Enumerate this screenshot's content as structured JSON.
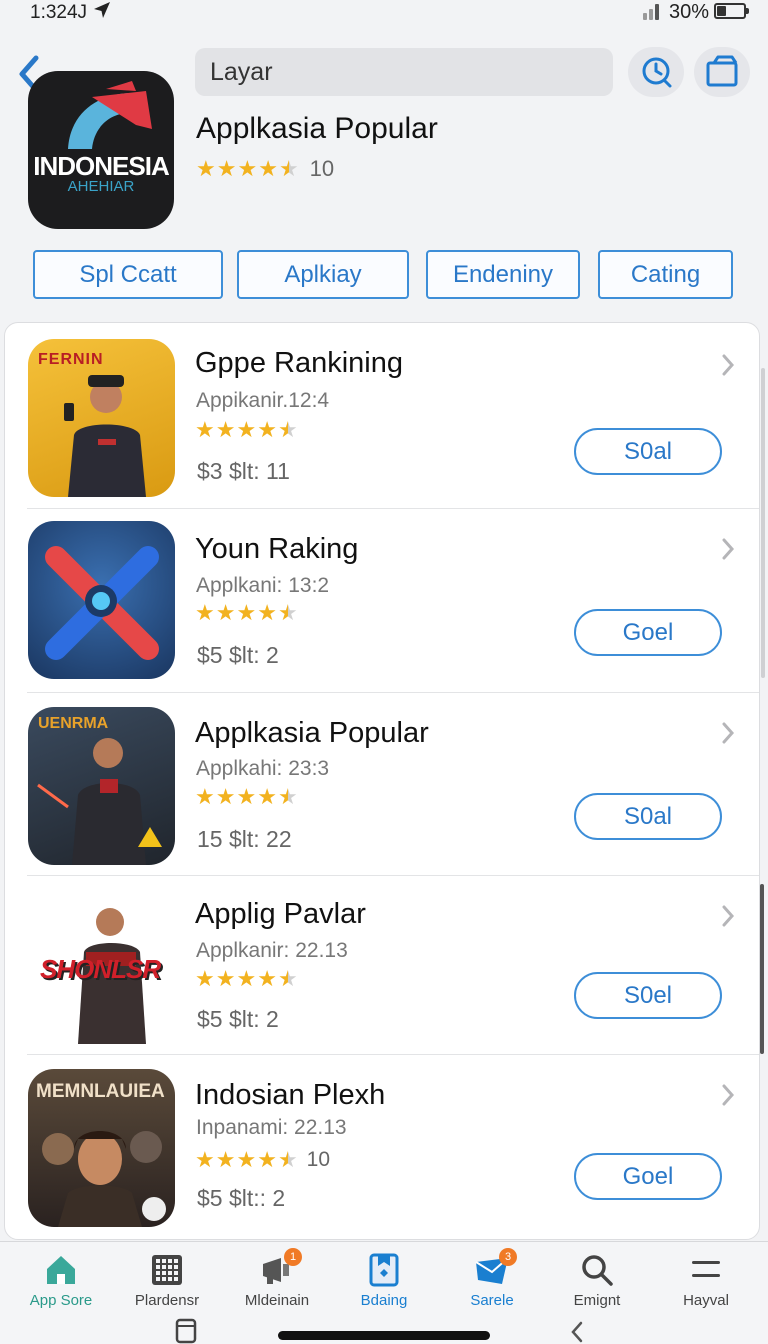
{
  "status": {
    "time": "1:324J",
    "battery": "30%"
  },
  "header": {
    "search_value": "Layar",
    "hero_title": "Applkasia Popular",
    "hero_rating_count": "10",
    "hero_icon_text": "INDONESIA",
    "hero_icon_subtext": "AHEHIAR",
    "hero_rating": 4.5
  },
  "chips": [
    {
      "label": "Spl Ccatt"
    },
    {
      "label": "Aplkiay"
    },
    {
      "label": "Endeniny"
    },
    {
      "label": "Cating"
    }
  ],
  "apps": [
    {
      "name": "Gppe Rankining",
      "sub": "Appikanir.12:4",
      "rating": 4.5,
      "rating_count": "",
      "price": "$3  $lt: 11",
      "button": "S0al",
      "icon_text": "FERNIN"
    },
    {
      "name": "Youn Raking",
      "sub": "Applkani: 13:2",
      "rating": 4.5,
      "rating_count": "",
      "price": "$5  $lt:  2",
      "button": "Goel",
      "icon_text": ""
    },
    {
      "name": "Applkasia Popular",
      "sub": "Applkahi: 23:3",
      "rating": 4.5,
      "rating_count": "",
      "price": "15  $lt: 22",
      "button": "S0al",
      "icon_text": "UENRMA"
    },
    {
      "name": "Applig Pavlar",
      "sub": "Applkanir: 22.13",
      "rating": 4.5,
      "rating_count": "",
      "price": "$5  $lt:  2",
      "button": "S0el",
      "icon_text": "SHONLSR"
    },
    {
      "name": "Indosian Plexh",
      "sub": "Inpanami: 22.13",
      "rating": 4.5,
      "rating_count": "10",
      "price": "$5  $lt::  2",
      "button": "Goel",
      "icon_text": "MEMNLAUIEA"
    }
  ],
  "tabs": [
    {
      "label": "App Sore",
      "icon": "home-icon",
      "active": true
    },
    {
      "label": "Plardensr",
      "icon": "grid-icon",
      "badge": ""
    },
    {
      "label": "Mldeinain",
      "icon": "megaphone-icon",
      "badge": "1"
    },
    {
      "label": "Bdaing",
      "icon": "bookmark-icon",
      "active": true
    },
    {
      "label": "Sarele",
      "icon": "mail-icon",
      "badge": "3",
      "active": true
    },
    {
      "label": "Emignt",
      "icon": "search-icon"
    },
    {
      "label": "Hayval",
      "icon": "menu-icon"
    }
  ],
  "colors": {
    "accent": "#2a78c8",
    "star": "#f2b21f",
    "badge": "#f07a26",
    "tab_active": "#1a7fd0"
  }
}
